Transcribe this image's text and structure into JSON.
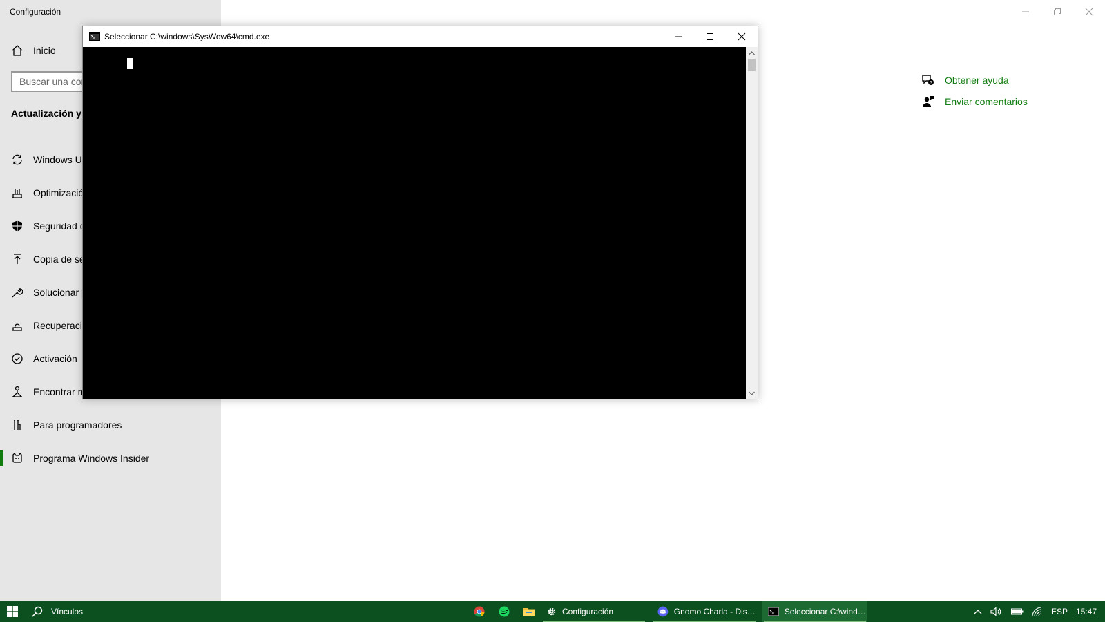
{
  "settings": {
    "app_title": "Configuración",
    "home_label": "Inicio",
    "search_placeholder": "Buscar una configuración",
    "section_heading": "Actualización y seguridad",
    "nav_items": [
      {
        "label": "Windows Update",
        "icon": "refresh-icon"
      },
      {
        "label": "Optimización de distribución",
        "icon": "delivery-optimization-icon"
      },
      {
        "label": "Seguridad de Windows",
        "icon": "shield-icon"
      },
      {
        "label": "Copia de seguridad",
        "icon": "backup-arrow-icon"
      },
      {
        "label": "Solucionar problemas",
        "icon": "wrench-icon"
      },
      {
        "label": "Recuperación",
        "icon": "recovery-icon"
      },
      {
        "label": "Activación",
        "icon": "check-circle-icon"
      },
      {
        "label": "Encontrar mi dispositivo",
        "icon": "find-device-icon"
      },
      {
        "label": "Para programadores",
        "icon": "developer-tools-icon"
      },
      {
        "label": "Programa Windows Insider",
        "icon": "insider-cat-icon",
        "active": true
      }
    ],
    "help_links": [
      {
        "label": "Obtener ayuda",
        "icon": "help-chat-icon"
      },
      {
        "label": "Enviar comentarios",
        "icon": "feedback-person-icon"
      }
    ],
    "accent_color": "#107c10"
  },
  "cmd": {
    "title": "Seleccionar C:\\windows\\SysWow64\\cmd.exe",
    "background_color": "#000000"
  },
  "taskbar": {
    "search_label": "Vínculos",
    "pinned": [
      "chrome-icon",
      "spotify-icon",
      "file-explorer-icon"
    ],
    "tasks": [
      {
        "label": "Configuración",
        "icon": "gear-icon"
      },
      {
        "label": "Gnomo Charla - Disc...",
        "icon": "discord-icon"
      },
      {
        "label": "Seleccionar C:\\windo...",
        "icon": "cmd-icon",
        "active": true
      }
    ],
    "language": "ESP",
    "time": "15:47",
    "background_color": "#0c5020"
  }
}
